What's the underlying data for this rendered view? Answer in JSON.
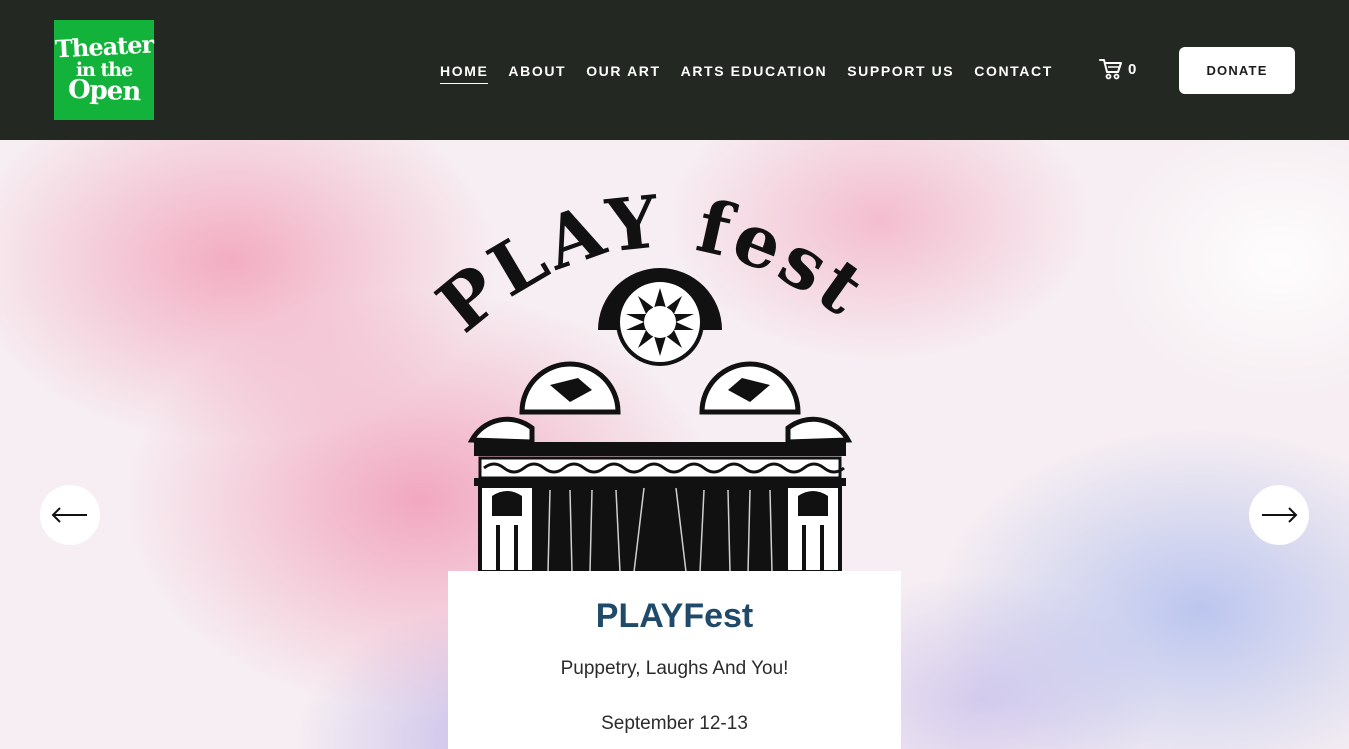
{
  "logo": {
    "line1": "Theater",
    "line2": "in the",
    "line3": "Open",
    "bg_color": "#12b23b"
  },
  "nav": {
    "items": [
      {
        "label": "HOME",
        "active": true
      },
      {
        "label": "ABOUT"
      },
      {
        "label": "OUR ART"
      },
      {
        "label": "ARTS EDUCATION"
      },
      {
        "label": "SUPPORT US"
      },
      {
        "label": "CONTACT"
      }
    ]
  },
  "cart": {
    "icon": "cart-icon",
    "count": "0"
  },
  "donate": {
    "label": "DONATE"
  },
  "hero": {
    "art_title": "PLAY fest",
    "prev_icon": "arrow-left-icon",
    "next_icon": "arrow-right-icon",
    "card": {
      "title": "PLAYFest",
      "subtitle": "Puppetry, Laughs And You!",
      "date": "September 12-13"
    }
  },
  "colors": {
    "header_bg": "#232922",
    "card_title": "#1f4a6a"
  }
}
